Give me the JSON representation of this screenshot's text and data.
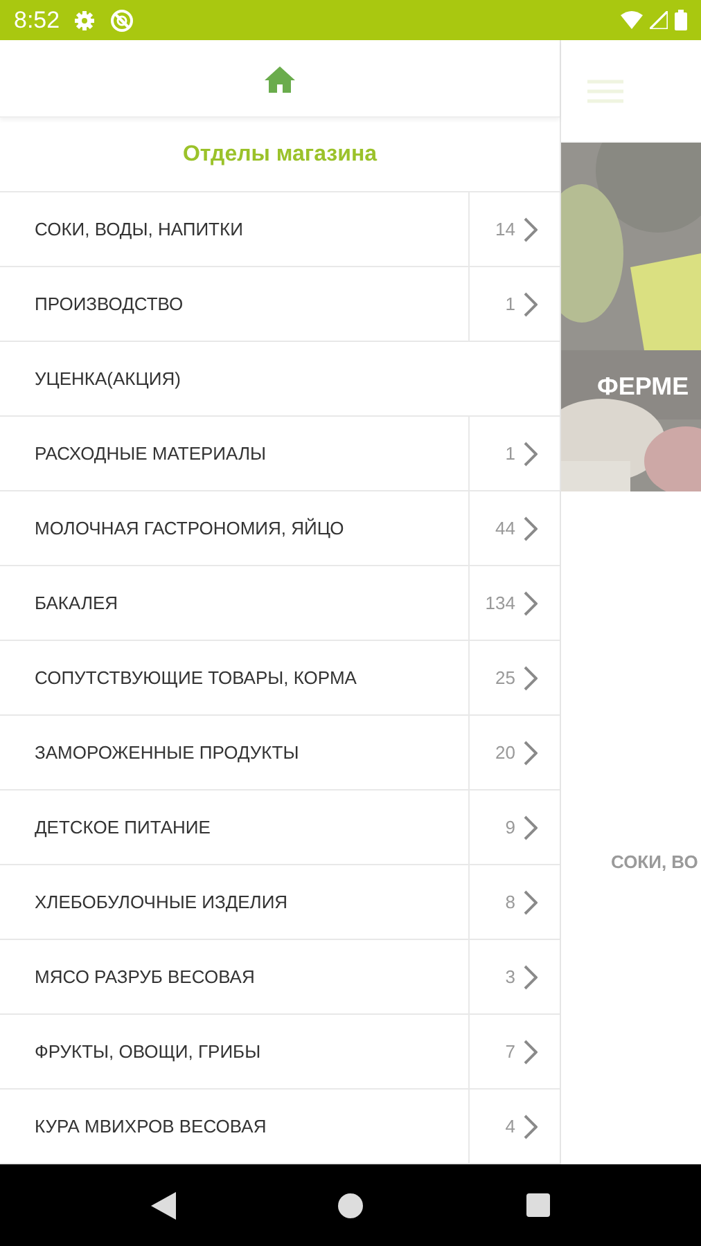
{
  "status_bar": {
    "time": "8:52"
  },
  "drawer": {
    "title": "Отделы магазина",
    "items": [
      {
        "label": "СОКИ, ВОДЫ, НАПИТКИ",
        "count": "14",
        "has_children": true
      },
      {
        "label": "ПРОИЗВОДСТВО",
        "count": "1",
        "has_children": true
      },
      {
        "label": "УЦЕНКА(АКЦИЯ)",
        "has_children": false
      },
      {
        "label": "РАСХОДНЫЕ МАТЕРИАЛЫ",
        "count": "1",
        "has_children": true
      },
      {
        "label": "МОЛОЧНАЯ ГАСТРОНОМИЯ, ЯЙЦО",
        "count": "44",
        "has_children": true
      },
      {
        "label": "БАКАЛЕЯ",
        "count": "134",
        "has_children": true
      },
      {
        "label": "СОПУТСТВУЮЩИЕ ТОВАРЫ, КОРМА",
        "count": "25",
        "has_children": true
      },
      {
        "label": "ЗАМОРОЖЕННЫЕ ПРОДУКТЫ",
        "count": "20",
        "has_children": true
      },
      {
        "label": "ДЕТСКОЕ ПИТАНИЕ",
        "count": "9",
        "has_children": true
      },
      {
        "label": "ХЛЕБОБУЛОЧНЫЕ ИЗДЕЛИЯ",
        "count": "8",
        "has_children": true
      },
      {
        "label": "МЯСО РАЗРУБ ВЕСОВАЯ",
        "count": "3",
        "has_children": true
      },
      {
        "label": "ФРУКТЫ, ОВОЩИ, ГРИБЫ",
        "count": "7",
        "has_children": true
      },
      {
        "label": "КУРА МВИХРОВ ВЕСОВАЯ",
        "count": "4",
        "has_children": true
      }
    ]
  },
  "background": {
    "banner": {
      "kind": "picture",
      "title": "ФЕРМЕ"
    },
    "category": "СОКИ, ВО"
  }
}
